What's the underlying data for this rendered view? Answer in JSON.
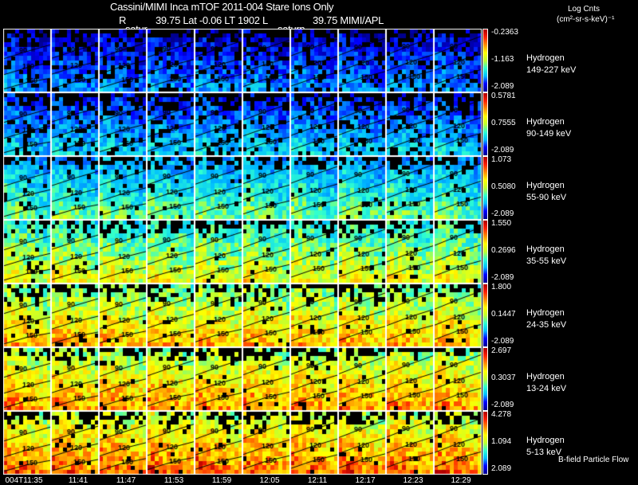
{
  "header": {
    "title": "Cassini/MIMI Inca mTOF  2011-004   Stare   Ions Only",
    "r_label": "R",
    "position_line": "39.75 Lat -0.06 LT 1902 L",
    "l_value": "39.75  MIMI/APL",
    "planet_marker_1": "satur",
    "planet_marker_2": "saturn"
  },
  "colorbar_title": {
    "line1": "Log Cnts",
    "line2": "(cm²-sr-s-keV)⁻¹"
  },
  "footer_note": "B-field Particle Flow",
  "chart_data": {
    "type": "heatmap",
    "layout": "7 energy rows x 10 time columns of angular images",
    "colormap": "rainbow (blue-cyan-green-yellow-red), black = no data",
    "contour_labels": [
      "90",
      "120",
      "150"
    ],
    "time_labels": [
      "004T11:35",
      "11:41",
      "11:47",
      "11:53",
      "11:59",
      "12:05",
      "12:11",
      "12:17",
      "12:23",
      "12:29"
    ],
    "rows": [
      {
        "species": "Hydrogen",
        "energy": "149-227 keV",
        "max": "-0.2363",
        "mid": "-1.163",
        "min": "-2.089"
      },
      {
        "species": "Hydrogen",
        "energy": "90-149 keV",
        "max": "0.5781",
        "mid": "0.7555",
        "min": "-2.089"
      },
      {
        "species": "Hydrogen",
        "energy": "55-90 keV",
        "max": "1.073",
        "mid": "0.5080",
        "min": "-2.089"
      },
      {
        "species": "Hydrogen",
        "energy": "35-55 keV",
        "max": "1.550",
        "mid": "0.2696",
        "min": "-2.089"
      },
      {
        "species": "Hydrogen",
        "energy": "24-35 keV",
        "max": "1.800",
        "mid": "0.1447",
        "min": "-2.089"
      },
      {
        "species": "Hydrogen",
        "energy": "13-24 keV",
        "max": "2.697",
        "mid": "0.3037",
        "min": "-2.089"
      },
      {
        "species": "Hydrogen",
        "energy": "5-13 keV",
        "max": "4.278",
        "mid": "1.094",
        "min": "2.089"
      }
    ]
  }
}
